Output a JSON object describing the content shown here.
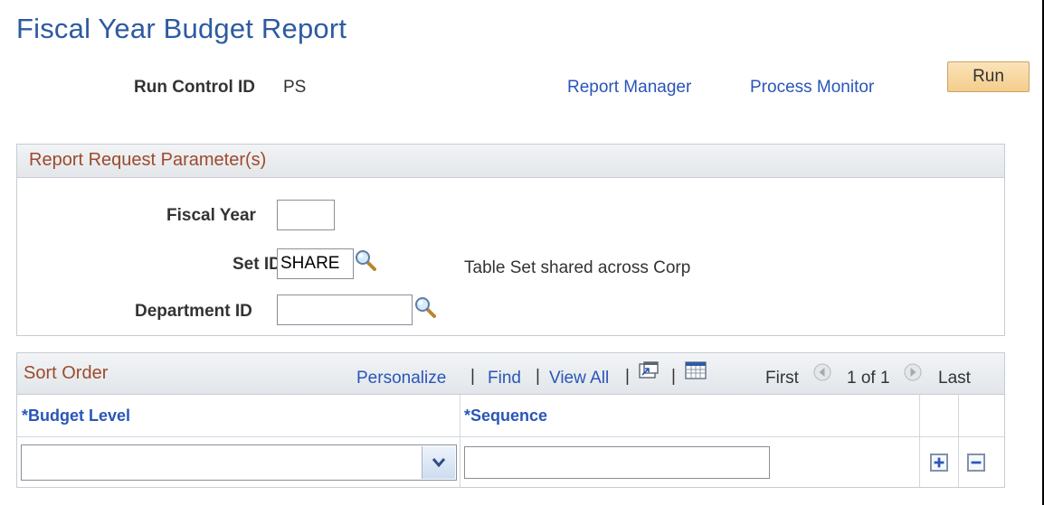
{
  "page": {
    "title": "Fiscal Year Budget Report"
  },
  "run_control": {
    "label": "Run Control ID",
    "value": "PS"
  },
  "links": {
    "report_manager": "Report Manager",
    "process_monitor": "Process Monitor"
  },
  "run_button": {
    "label": "Run"
  },
  "parameters": {
    "title": "Report Request Parameter(s)",
    "fiscal_year": {
      "label": "Fiscal Year",
      "value": ""
    },
    "set_id": {
      "label": "Set ID",
      "value": "SHARE",
      "description": "Table Set shared across Corp"
    },
    "department_id": {
      "label": "Department ID",
      "value": ""
    }
  },
  "sort_order": {
    "title": "Sort Order",
    "nav": {
      "personalize": "Personalize",
      "find": "Find",
      "view_all": "View All",
      "separator": "|",
      "first": "First",
      "range": "1 of 1",
      "last": "Last"
    },
    "columns": [
      "*Budget Level",
      "*Sequence"
    ],
    "rows": [
      {
        "budget_level": "",
        "sequence": ""
      }
    ]
  },
  "icons": {
    "lookup": "magnifier-icon",
    "new_window": "new-window-icon",
    "download": "grid-download-icon",
    "prev": "prev-arrow-icon",
    "next": "next-arrow-icon",
    "add_row": "plus-icon",
    "delete_row": "minus-icon"
  },
  "colors": {
    "title": "#2d5aa0",
    "link": "#2a55b8",
    "section_title": "#9c4b2b",
    "run_button": "#f4cd8c"
  }
}
